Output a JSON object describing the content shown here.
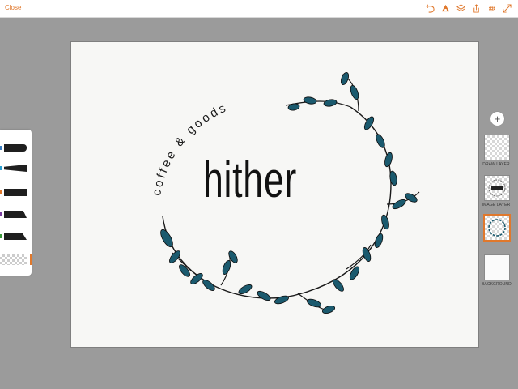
{
  "topbar": {
    "close_label": "Close",
    "icons": [
      "undo-icon",
      "brush-palette-icon",
      "layers-icon",
      "share-icon",
      "settings-gear-icon",
      "fullscreen-icon"
    ],
    "accent_color": "#e0782c"
  },
  "artwork": {
    "title": "hither",
    "tagline": "coffee & goods",
    "leaf_color": "#1b5a6e"
  },
  "tools": {
    "brushes": [
      {
        "name": "brush-1",
        "band_color": "#3b7fc4"
      },
      {
        "name": "brush-2",
        "band_color": "#2b9fd0"
      },
      {
        "name": "brush-3",
        "band_color": "#e0782c"
      },
      {
        "name": "brush-4",
        "band_color": "#7b3fa0"
      },
      {
        "name": "brush-5",
        "band_color": "#3a9a3a"
      }
    ]
  },
  "layers": {
    "add_label": "+",
    "items": [
      {
        "label": "DRAW LAYER",
        "selected": false
      },
      {
        "label": "IMAGE LAYER",
        "selected": false
      },
      {
        "label": "",
        "selected": true
      },
      {
        "label": "BACKGROUND",
        "selected": false
      }
    ]
  }
}
